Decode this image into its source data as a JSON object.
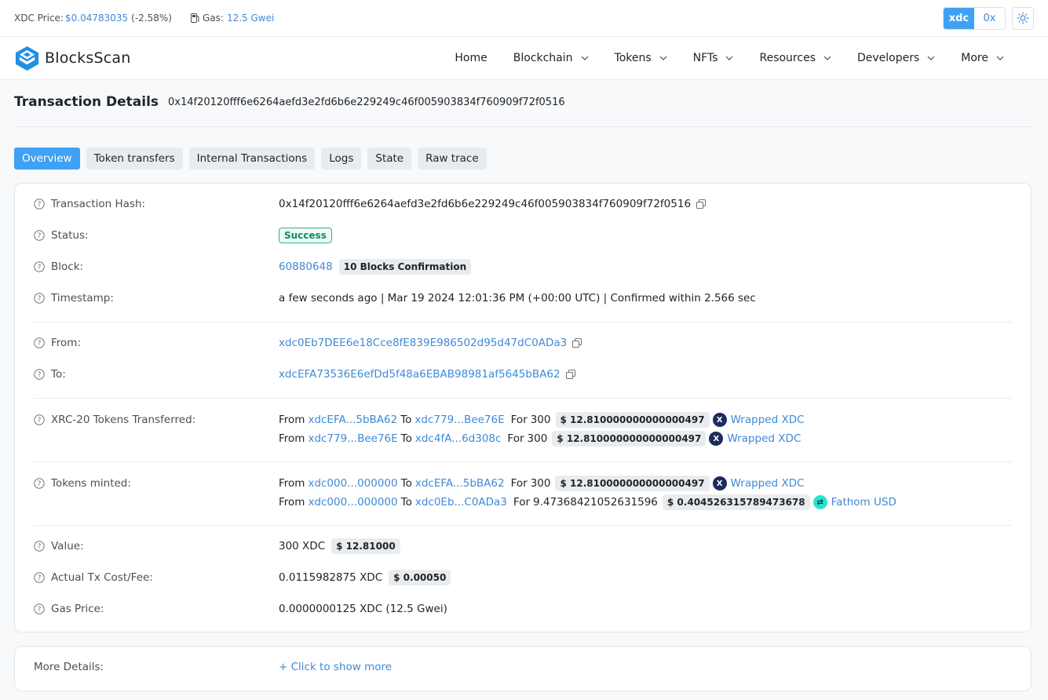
{
  "topbar": {
    "price_label": "XDC Price:",
    "price_value": "$0.04783035",
    "price_change": "(-2.58%)",
    "gas_label": "Gas:",
    "gas_value": "12.5 Gwei",
    "prefix_options": [
      "xdc",
      "0x"
    ],
    "active_prefix": "xdc"
  },
  "brand": {
    "name": "BlocksScan"
  },
  "nav": {
    "items": [
      {
        "label": "Home",
        "dropdown": false
      },
      {
        "label": "Blockchain",
        "dropdown": true
      },
      {
        "label": "Tokens",
        "dropdown": true
      },
      {
        "label": "NFTs",
        "dropdown": true
      },
      {
        "label": "Resources",
        "dropdown": true
      },
      {
        "label": "Developers",
        "dropdown": true
      },
      {
        "label": "More",
        "dropdown": true
      }
    ]
  },
  "page": {
    "title": "Transaction Details",
    "hash": "0x14f20120fff6e6264aefd3e2fd6b6e229249c46f005903834f760909f72f0516"
  },
  "tabs": [
    "Overview",
    "Token transfers",
    "Internal Transactions",
    "Logs",
    "State",
    "Raw trace"
  ],
  "details": {
    "tx_hash_label": "Transaction Hash:",
    "tx_hash": "0x14f20120fff6e6264aefd3e2fd6b6e229249c46f005903834f760909f72f0516",
    "status_label": "Status:",
    "status": "Success",
    "block_label": "Block:",
    "block": "60880648",
    "block_confirmations": "10 Blocks Confirmation",
    "timestamp_label": "Timestamp:",
    "timestamp": "a few seconds ago | Mar 19 2024 12:01:36 PM (+00:00 UTC) | Confirmed within 2.566 sec",
    "from_label": "From:",
    "from": "xdc0Eb7DEE6e18Cce8fE839E986502d95d47dC0ADa3",
    "to_label": "To:",
    "to": "xdcEFA73536E6efDd5f48a6EBAB98981af5645bBA62",
    "xrc20_label": "XRC-20 Tokens Transferred:",
    "xrc20": [
      {
        "from_word": "From",
        "from": "xdcEFA...5bBA62",
        "to_word": "To",
        "to": "xdc779...Bee76E",
        "for_word": "For",
        "amount": "300",
        "usd": "$ 12.810000000000000497",
        "token": "Wrapped XDC",
        "icon": "X"
      },
      {
        "from_word": "From",
        "from": "xdc779...Bee76E",
        "to_word": "To",
        "to": "xdc4fA...6d308c",
        "for_word": "For",
        "amount": "300",
        "usd": "$ 12.810000000000000497",
        "token": "Wrapped XDC",
        "icon": "X"
      }
    ],
    "minted_label": "Tokens minted:",
    "minted": [
      {
        "from_word": "From",
        "from": "xdc000...000000",
        "to_word": "To",
        "to": "xdcEFA...5bBA62",
        "for_word": "For",
        "amount": "300",
        "usd": "$ 12.810000000000000497",
        "token": "Wrapped XDC",
        "icon": "X"
      },
      {
        "from_word": "From",
        "from": "xdc000...000000",
        "to_word": "To",
        "to": "xdc0Eb...C0ADa3",
        "for_word": "For",
        "amount": "9.47368421052631596",
        "usd": "$ 0.404526315789473678",
        "token": "Fathom USD",
        "icon": "⇄"
      }
    ],
    "value_label": "Value:",
    "value": "300 XDC",
    "value_usd": "$ 12.81000",
    "fee_label": "Actual Tx Cost/Fee:",
    "fee": "0.0115982875 XDC",
    "fee_usd": "$ 0.00050",
    "gas_price_label": "Gas Price:",
    "gas_price": "0.0000000125 XDC (12.5 Gwei)"
  },
  "more": {
    "label": "More Details:",
    "link": "+ Click to show more"
  },
  "colors": {
    "accent": "#3fa1f5",
    "link": "#3f8ad6",
    "success": "#0c8b62"
  }
}
